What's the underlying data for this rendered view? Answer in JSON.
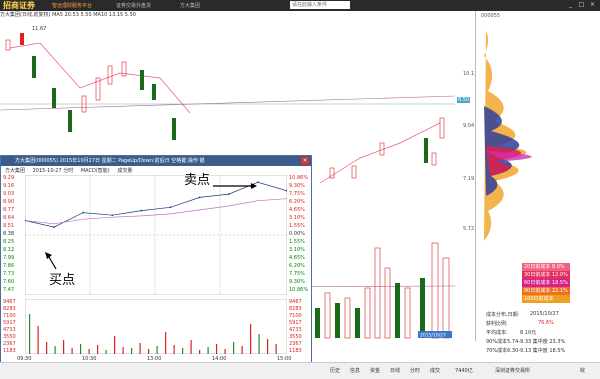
{
  "titlebar": {
    "logo": "招商证券",
    "slogan": "智远理财服务平台",
    "context": "证券交易外盘货",
    "stock_name": "方大集团",
    "search_placeholder": "请在此输入条件",
    "win_buttons": [
      "_",
      "□",
      "×"
    ]
  },
  "kline": {
    "info": "方大集团(日线,前复权)  MA5 20.53  5.50  MA10 13.15  5.50",
    "high_label": "11.67",
    "price_ticks": [
      "10.11",
      "9.04",
      "7.19",
      "5.72"
    ],
    "highlight_price": "8.50",
    "date_tag": "2015/10/27"
  },
  "chips": {
    "code": "000055",
    "legend": [
      "20日前成本 8.0%",
      "30日前成本 12.0%",
      "60日前成本 18.5%",
      "90日前成本 22.1%",
      "100日前成本 48.1%"
    ],
    "legend_colors": [
      "#f06080",
      "#e23060",
      "#d42090",
      "#f07020",
      "#f0a020"
    ],
    "date_label": "成本分布,日期:",
    "date_value": "2015/10/27",
    "profit_label": "获利比例:",
    "profit_value": "76.6%",
    "avg_label": "平均成本:",
    "avg_value": "8.10元",
    "c90": "90%成本5.74-9.33 集中度 23.3%",
    "c70": "70%成本6.30-9.13 集中度 18.5%"
  },
  "popup": {
    "title": "方大集团(000055)  2015年10月27日  星期二  PageUp/Down:前后日  空格键:操作  键",
    "close": "×",
    "subtitle": [
      "方大集团",
      "2015-10-27 分时",
      "MACD(智能)",
      "成交量"
    ],
    "ref_price": "8.38",
    "left_ticks": [
      "9.29",
      "9.16",
      "9.03",
      "8.90",
      "8.77",
      "8.64",
      "8.51",
      "8.38",
      "8.25",
      "8.12",
      "7.99",
      "7.86",
      "7.73",
      "7.60",
      "7.47"
    ],
    "right_ticks": [
      "10.86%",
      "9.30%",
      "7.75%",
      "6.20%",
      "4.65%",
      "3.10%",
      "1.55%",
      "0.00%",
      "1.55%",
      "3.10%",
      "4.65%",
      "6.20%",
      "7.75%",
      "9.30%",
      "10.86%"
    ],
    "vol_left": [
      "9467",
      "8283",
      "7100",
      "5917",
      "4733",
      "3550",
      "2367",
      "1183"
    ],
    "vol_right": [
      "9467",
      "8283",
      "7100",
      "5917",
      "4733",
      "3550",
      "2367",
      "1183"
    ],
    "time_ticks": [
      "09:30",
      "10:30",
      "13:00",
      "14:00",
      "15:00"
    ],
    "sell_label": "卖点",
    "buy_label": "买点"
  },
  "bottombar": {
    "items": [
      "历史",
      "信息",
      "资金",
      "日线",
      "分时",
      "成交",
      "7440亿",
      "深圳证券交易所",
      "收"
    ]
  },
  "chart_data": {
    "type": "line",
    "title": "",
    "x": [
      "09:30",
      "10:00",
      "10:30",
      "11:00",
      "11:30",
      "13:00",
      "13:30",
      "14:00",
      "14:30",
      "15:00"
    ],
    "series": [
      {
        "name": "",
        "values": [
          8.6,
          8.5,
          8.72,
          8.68,
          8.75,
          8.8,
          8.95,
          9.0,
          9.18,
          9.05
        ]
      },
      {
        "name": "",
        "values": [
          8.6,
          8.55,
          8.62,
          8.65,
          8.67,
          8.7,
          8.76,
          8.82,
          8.9,
          8.93
        ]
      }
    ],
    "ylim": [
      7.47,
      9.29
    ]
  }
}
